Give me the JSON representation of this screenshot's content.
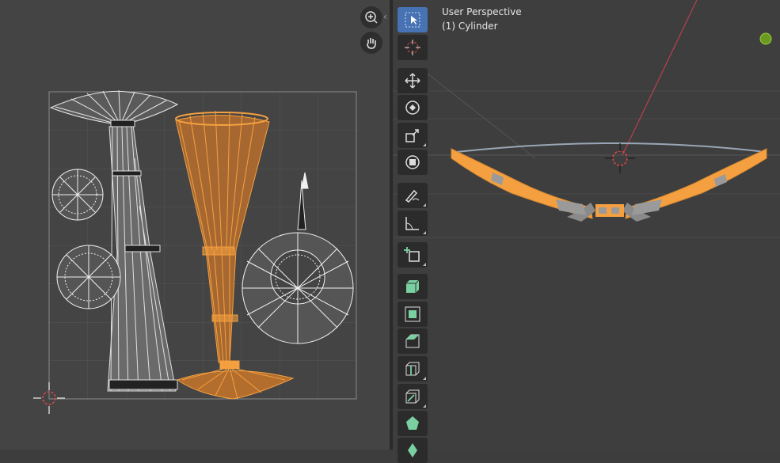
{
  "viewport": {
    "perspective_label": "User Perspective",
    "object_label": "(1) Cylinder"
  },
  "uv_editor": {
    "nav_buttons": [
      "zoom-icon",
      "hand-icon"
    ]
  },
  "toolbar": {
    "tools": [
      {
        "name": "select-box-tool",
        "icon": "select-box-icon",
        "active": true
      },
      {
        "name": "cursor-tool",
        "icon": "cursor-icon",
        "active": false
      },
      {
        "name": "move-tool",
        "icon": "move-icon",
        "active": false
      },
      {
        "name": "rotate-tool",
        "icon": "rotate-icon",
        "active": false
      },
      {
        "name": "scale-tool",
        "icon": "scale-icon",
        "active": false
      },
      {
        "name": "transform-tool",
        "icon": "transform-icon",
        "active": false
      },
      {
        "name": "annotate-tool",
        "icon": "annotate-icon",
        "active": false
      },
      {
        "name": "measure-tool",
        "icon": "measure-icon",
        "active": false
      },
      {
        "name": "add-cube-tool",
        "icon": "add-cube-icon",
        "active": false
      },
      {
        "name": "extrude-tool",
        "icon": "extrude-icon",
        "active": false
      },
      {
        "name": "inset-tool",
        "icon": "inset-icon",
        "active": false
      },
      {
        "name": "bevel-tool",
        "icon": "bevel-icon",
        "active": false
      },
      {
        "name": "loop-cut-tool",
        "icon": "loop-cut-icon",
        "active": false
      },
      {
        "name": "knife-tool",
        "icon": "knife-icon",
        "active": false
      },
      {
        "name": "poly-build-tool",
        "icon": "poly-build-icon",
        "active": false
      },
      {
        "name": "spin-tool",
        "icon": "spin-icon",
        "active": false
      }
    ]
  },
  "colors": {
    "selected": "#f5a040",
    "unselected": "#e8e8e8",
    "active_tool": "#4772b3",
    "cursor": "#e04848"
  }
}
